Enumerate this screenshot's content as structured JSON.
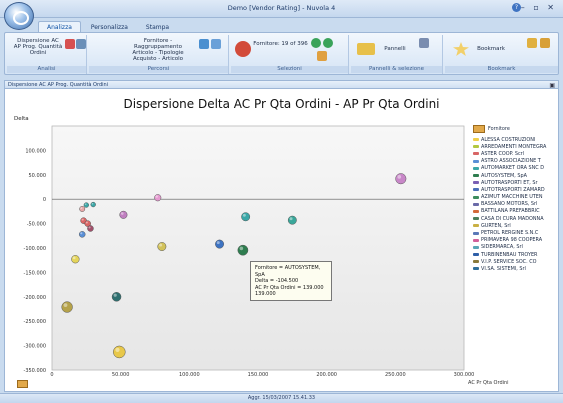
{
  "window": {
    "title": "Demo [Vendor Rating] - Nuvola 4"
  },
  "tabs": [
    {
      "label": "Analizza",
      "active": true
    },
    {
      "label": "Personalizza",
      "active": false
    },
    {
      "label": "Stampa",
      "active": false
    }
  ],
  "ribbon": {
    "analisi": {
      "label": "Analisi",
      "button": "Dispersione AC AP Prog. Quantità Ordini"
    },
    "percorsi": {
      "label": "Percorsi",
      "button": "Fornitore - Raggruppamento Articolo - Tipologie Acquisto - Articolo"
    },
    "selezioni": {
      "label": "Selezioni",
      "button": "Fornitore: 19 of 396"
    },
    "pannelli": {
      "label": "Pannelli & selezione",
      "button": "Pannelli"
    },
    "bookmark": {
      "label": "Bookmark",
      "button": "Bookmark"
    }
  },
  "subheader": {
    "text": "Dispersione AC AP Prog. Quantità Ordini"
  },
  "status": {
    "text": "Aggr. 15/03/2007 15.41.33"
  },
  "tooltip": {
    "line1": "Fornitore = AUTOSYSTEM, SpA",
    "line2": "Delta = -104.500",
    "line3": "AC Pr Qta Ordini = 139.000",
    "line4": "139.000"
  },
  "legend": {
    "title": "Fornitore",
    "items": [
      {
        "label": "ALESSA COSTRUZIONI",
        "color": "#f0d04a"
      },
      {
        "label": "ARREDAMENTI MONTEGRA",
        "color": "#b3c840"
      },
      {
        "label": "ASTER COOP. Scrl",
        "color": "#d86565"
      },
      {
        "label": "ASTRO ASSOCIAZIONE T",
        "color": "#5a8fd6"
      },
      {
        "label": "AUTOMARKET ORA SNC D",
        "color": "#3aa7a7"
      },
      {
        "label": "AUTOSYSTEM, SpA",
        "color": "#2e7d4f"
      },
      {
        "label": "AUTOTRASPORTI ET, Sr",
        "color": "#7a5fb4"
      },
      {
        "label": "AUTOTRASPORTI ZAMARD",
        "color": "#4a6fb8"
      },
      {
        "label": "AZIMUT MACCHINE UTEN",
        "color": "#3d8d5d"
      },
      {
        "label": "BASSANO MOTORS, Srl",
        "color": "#6a6aa8"
      },
      {
        "label": "BATTILANA PREFABBRIC",
        "color": "#d46a3a"
      },
      {
        "label": "CASA DI CURA MADONNA",
        "color": "#4a7e5a"
      },
      {
        "label": "GURTEN, Srl",
        "color": "#c9b044"
      },
      {
        "label": "PETROL RERGINE S.N.C",
        "color": "#5a78b8"
      },
      {
        "label": "PRIMAVERA 98 COOPERA",
        "color": "#d2609a"
      },
      {
        "label": "SIDERMARCA, Srl",
        "color": "#58a6b6"
      },
      {
        "label": "TURBINENBAU TROYER",
        "color": "#2f5fa8"
      },
      {
        "label": "V.I.P. SERVICE SOC. CO",
        "color": "#8a7a3a"
      },
      {
        "label": "VI.SA. SISTEMI, Srl",
        "color": "#2f6f9a"
      }
    ]
  },
  "chart_data": {
    "type": "scatter",
    "title": "Dispersione Delta AC Pr Qta Ordini - AP Pr Qta Ordini",
    "xlabel": "AC Pr Qta Ordini",
    "ylabel": "Delta",
    "xlim": [
      0,
      300000
    ],
    "ylim": [
      -350000,
      150000
    ],
    "x_ticks": [
      "0",
      "50.000",
      "100.000",
      "150.000",
      "200.000",
      "250.000",
      "300.000"
    ],
    "y_ticks": [
      "100.000",
      "50.000",
      "0",
      "-50.000",
      "-100.000",
      "-150.000",
      "-200.000",
      "-250.000",
      "-300.000",
      "-350.000"
    ],
    "grid": false,
    "legend_position": "right",
    "points": [
      {
        "x": 254000,
        "y": 42000,
        "color": "#c887c8",
        "size": 3.5
      },
      {
        "x": 77000,
        "y": 3000,
        "color": "#e59ad0",
        "size": 2.2
      },
      {
        "x": 52000,
        "y": -32000,
        "color": "#c07fc0",
        "size": 2.5
      },
      {
        "x": 30000,
        "y": -11000,
        "color": "#3aa7a7",
        "size": 1.6
      },
      {
        "x": 25000,
        "y": -12000,
        "color": "#3aa7a7",
        "size": 1.6
      },
      {
        "x": 22000,
        "y": -20000,
        "color": "#e8a8a8",
        "size": 1.8
      },
      {
        "x": 23000,
        "y": -44000,
        "color": "#d86565",
        "size": 2.0
      },
      {
        "x": 26000,
        "y": -50000,
        "color": "#d86565",
        "size": 2.0
      },
      {
        "x": 28000,
        "y": -60000,
        "color": "#a0506a",
        "size": 2.0
      },
      {
        "x": 22000,
        "y": -72000,
        "color": "#5a8fd6",
        "size": 2.0
      },
      {
        "x": 141000,
        "y": -36000,
        "color": "#3aa7a7",
        "size": 2.8
      },
      {
        "x": 175000,
        "y": -43000,
        "color": "#3aa79a",
        "size": 2.8
      },
      {
        "x": 122000,
        "y": -92000,
        "color": "#3d73c2",
        "size": 2.8
      },
      {
        "x": 139000,
        "y": -104500,
        "color": "#2e7d4f",
        "size": 3.4
      },
      {
        "x": 80000,
        "y": -97000,
        "color": "#d2c25a",
        "size": 2.8
      },
      {
        "x": 17000,
        "y": -123000,
        "color": "#e4d45a",
        "size": 2.6
      },
      {
        "x": 47000,
        "y": -200000,
        "color": "#2e6f6f",
        "size": 3.0
      },
      {
        "x": 11000,
        "y": -221000,
        "color": "#b5a24a",
        "size": 3.6
      },
      {
        "x": 49000,
        "y": -313000,
        "color": "#e8c84a",
        "size": 4.0
      }
    ]
  }
}
